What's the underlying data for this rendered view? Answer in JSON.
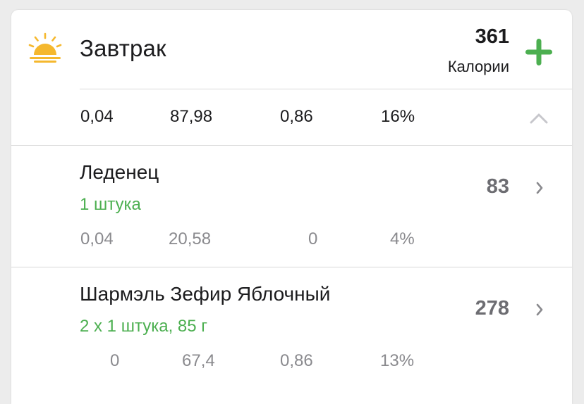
{
  "meal": {
    "title": "Завтрак",
    "calories_value": "361",
    "calories_label": "Калории",
    "icon": "sunrise-icon",
    "add_icon": "plus-icon",
    "accent_color": "#4caf50"
  },
  "summary": {
    "values": [
      "0,04",
      "87,98",
      "0,86",
      "16%"
    ],
    "toggle_icon": "chevron-up-icon"
  },
  "items": [
    {
      "name": "Леденец",
      "portion": "1 штука",
      "calories": "83",
      "values": [
        "0,04",
        "20,58",
        "0",
        "4%"
      ]
    },
    {
      "name": "Шармэль Зефир Яблочный",
      "portion": "2 x 1 штука, 85 г",
      "calories": "278",
      "values": [
        "0",
        "67,4",
        "0,86",
        "13%"
      ]
    }
  ]
}
